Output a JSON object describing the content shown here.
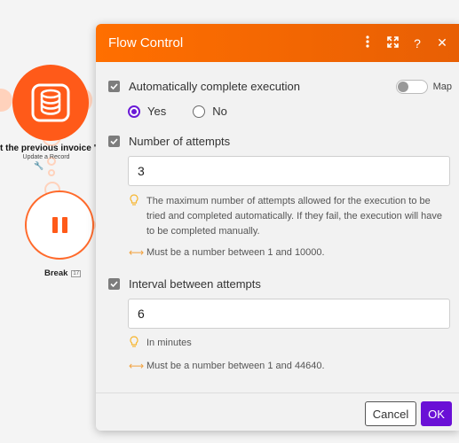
{
  "canvas": {
    "module_label": "t the previous invoice \"close",
    "module_sublabel": "Update a Record",
    "break_label": "Break",
    "break_id": "17"
  },
  "dialog": {
    "title": "Flow Control",
    "header_icons": [
      "more-vertical-icon",
      "expand-icon",
      "help-icon",
      "close-icon"
    ],
    "auto_complete": {
      "label": "Automatically complete execution",
      "map_label": "Map",
      "map_enabled": false,
      "options": {
        "yes": "Yes",
        "no": "No"
      },
      "selected": "Yes"
    },
    "attempts": {
      "label": "Number of attempts",
      "value": "3",
      "hint": "The maximum number of attempts allowed for the execution to be tried and completed automatically. If they fail, the execution will have to be completed manually.",
      "range": "Must be a number between 1 and 10000."
    },
    "interval": {
      "label": "Interval between attempts",
      "value": "6",
      "hint": "In minutes",
      "range": "Must be a number between 1 and 44640."
    },
    "footer": {
      "cancel_label": "Cancel",
      "ok_label": "OK"
    }
  },
  "colors": {
    "brand_orange": "#ff6a00",
    "accent_purple": "#6a10d6"
  }
}
